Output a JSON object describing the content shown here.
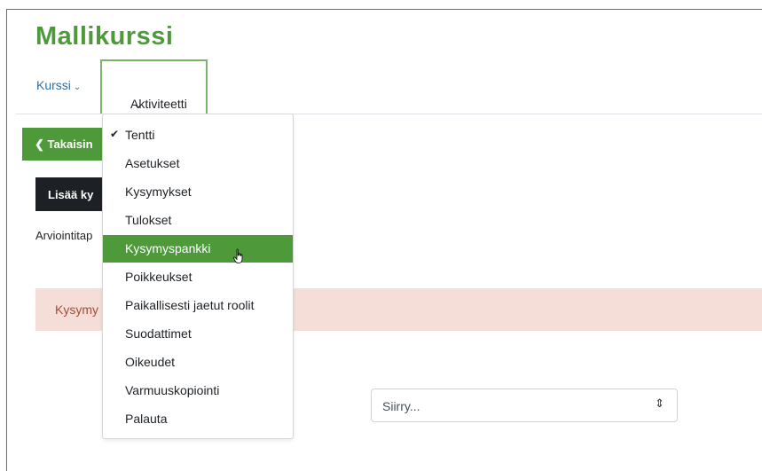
{
  "course": {
    "title": "Mallikurssi"
  },
  "nav": {
    "course_label": "Kurssi",
    "activity_label": "Aktiviteetti",
    "chevron": "⌄"
  },
  "page": {
    "back_label": "Takaisin",
    "add_label": "Lisää ky",
    "grading_text": "Arviointitap",
    "alert_text": "Kysymy"
  },
  "jump": {
    "placeholder": "Siirry...",
    "arrows": "⇕"
  },
  "dropdown": {
    "items": [
      {
        "label": "Tentti",
        "checked": true
      },
      {
        "label": "Asetukset"
      },
      {
        "label": "Kysymykset"
      },
      {
        "label": "Tulokset"
      },
      {
        "label": "Kysymyspankki",
        "active": true
      },
      {
        "label": "Poikkeukset"
      },
      {
        "label": "Paikallisesti jaetut roolit"
      },
      {
        "label": "Suodattimet"
      },
      {
        "label": "Oikeudet"
      },
      {
        "label": "Varmuuskopiointi"
      },
      {
        "label": "Palauta"
      }
    ]
  },
  "colors": {
    "brand_green": "#4e9a3b",
    "alert_bg": "#f6ded8",
    "alert_text": "#a14e38"
  }
}
